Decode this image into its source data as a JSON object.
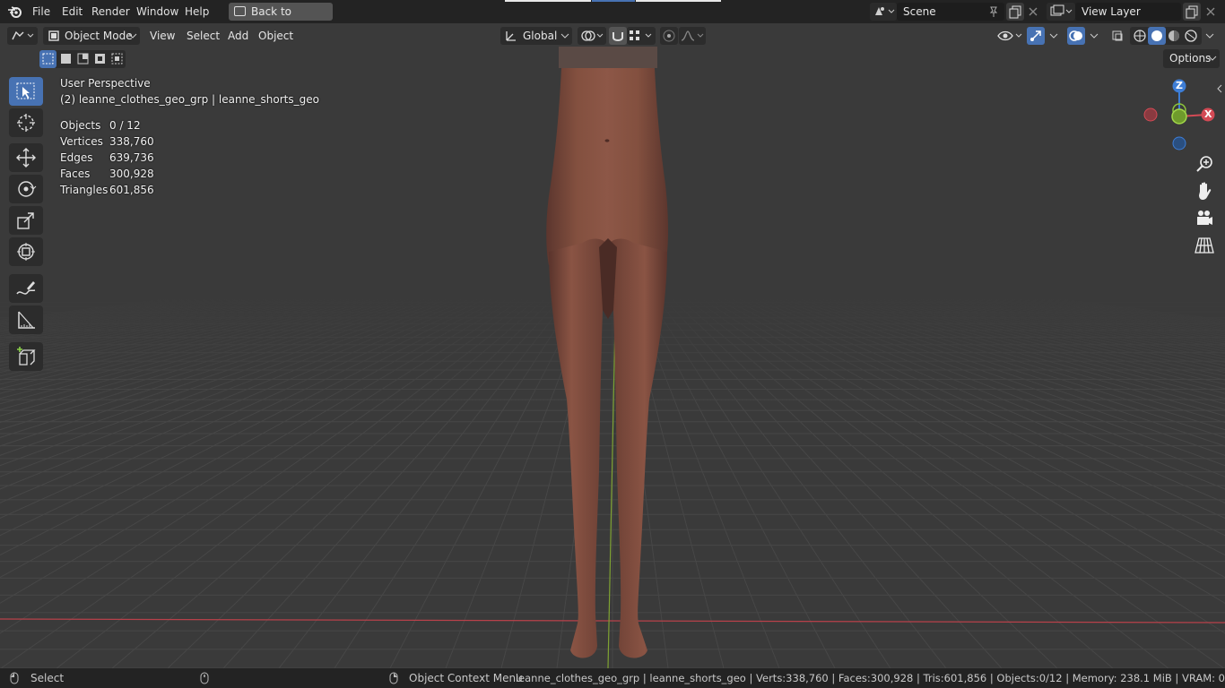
{
  "menu": {
    "file": "File",
    "edit": "Edit",
    "render": "Render",
    "window": "Window",
    "help": "Help",
    "back_button": "Back to Previous"
  },
  "scene": {
    "label": "Scene",
    "icon": "scene-icon"
  },
  "view_layer": {
    "label": "View Layer",
    "icon": "view-layer-icon"
  },
  "viewport_header": {
    "mode": "Object Mode",
    "view": "View",
    "select": "Select",
    "add": "Add",
    "object": "Object",
    "transform_orientation": "Global",
    "options": "Options"
  },
  "overlay": {
    "perspective": "User Perspective",
    "active_object": "(2) leanne_clothes_geo_grp | leanne_shorts_geo",
    "stats": [
      {
        "key": "Objects",
        "value": "0 / 12"
      },
      {
        "key": "Vertices",
        "value": "338,760"
      },
      {
        "key": "Edges",
        "value": "639,736"
      },
      {
        "key": "Faces",
        "value": "300,928"
      },
      {
        "key": "Triangles",
        "value": "601,856"
      }
    ]
  },
  "gizmo": {
    "z": "Z",
    "x": "X"
  },
  "toolbar_tools": [
    "select-box-icon",
    "cursor-icon",
    "move-icon",
    "rotate-icon",
    "scale-icon",
    "transform-icon",
    "annotate-icon",
    "measure-icon",
    "add-cube-icon"
  ],
  "statusbar": {
    "select": "Select",
    "context_menu": "Object Context Menu",
    "info": "leanne_clothes_geo_grp | leanne_shorts_geo | Verts:338,760 | Faces:300,928 | Tris:601,856 | Objects:0/12 | Memory: 238.1 MiB | VRAM: 0"
  },
  "colors": {
    "accent": "#4772b3",
    "x_axis": "#e04050",
    "y_axis": "#8cc43a",
    "z_axis": "#3d7dd6",
    "skin": "#8a5548"
  }
}
